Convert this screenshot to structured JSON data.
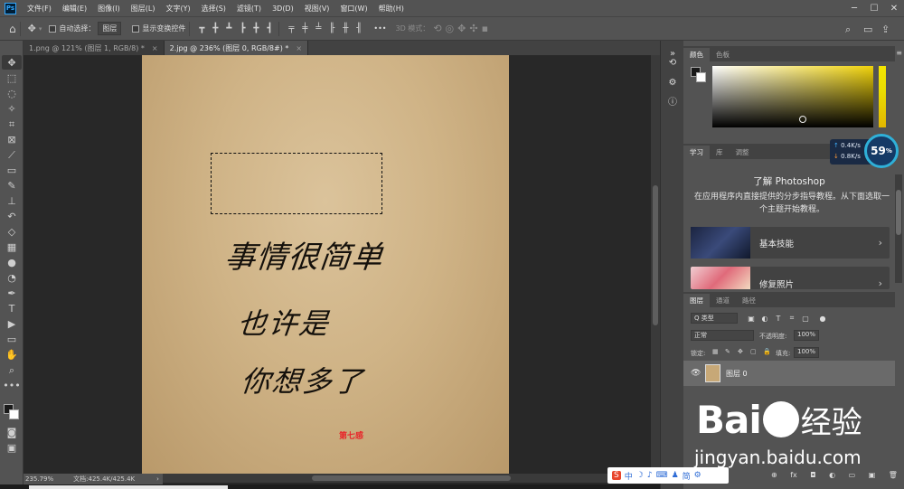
{
  "menubar": {
    "logo": "Ps",
    "items": [
      "文件(F)",
      "编辑(E)",
      "图像(I)",
      "图层(L)",
      "文字(Y)",
      "选择(S)",
      "滤镜(T)",
      "3D(D)",
      "视图(V)",
      "窗口(W)",
      "帮助(H)"
    ],
    "window_controls": [
      "─",
      "☐",
      "✕"
    ]
  },
  "optionsbar": {
    "home": "⌂",
    "move": "✥",
    "auto_select_label": "自动选择：",
    "auto_select_value": "图层",
    "show_transform_label": "显示变换控件",
    "more": "•••",
    "mode_3d_label": "3D 模式："
  },
  "tabs": [
    {
      "label": "1.png @ 121% (图层 1, RGB/8) *",
      "close": "×"
    },
    {
      "label": "2.jpg @ 236% (图层 0, RGB/8#) *",
      "close": "×"
    }
  ],
  "document": {
    "line1": "事情很简单",
    "line2": "也许是",
    "line3": "你想多了",
    "stamp": "第七感"
  },
  "status": {
    "zoom": "235.79%",
    "doc_info": "文档:425.4K/425.4K",
    "arrow": "›"
  },
  "color_panel": {
    "tabs": [
      "颜色",
      "色板"
    ],
    "menu": "≡"
  },
  "learn_panel": {
    "tabs": [
      "学习",
      "库",
      "调整"
    ],
    "title": "了解 Photoshop",
    "description": "在应用程序内直接提供的分步指导教程。从下面选取一个主题开始教程。",
    "cards": [
      {
        "label": "基本技能",
        "arrow": "›"
      },
      {
        "label": "修复照片",
        "arrow": "›"
      }
    ]
  },
  "net_gauge": {
    "up": "0.4K/s",
    "down": "0.8K/s",
    "percent": "59",
    "percent_sign": "%"
  },
  "layers_panel": {
    "tabs": [
      "图层",
      "通道",
      "路径"
    ],
    "filter": "Q 类型",
    "blend_mode": "正常",
    "opacity_label": "不透明度:",
    "opacity_value": "100%",
    "lock_label": "锁定:",
    "fill_label": "填充:",
    "fill_value": "100%",
    "layer_name": "图层 0",
    "bottom_icons": [
      "⊕",
      "fx",
      "◘",
      "◐",
      "▭",
      "▣",
      "🗑"
    ]
  },
  "watermark": {
    "brand_left": "Bai",
    "brand_right": "经验",
    "url": "jingyan.baidu.com"
  },
  "ime": {
    "items": [
      "中",
      "☽",
      "♪",
      "⌨",
      "♟",
      "简",
      "⚙"
    ]
  }
}
